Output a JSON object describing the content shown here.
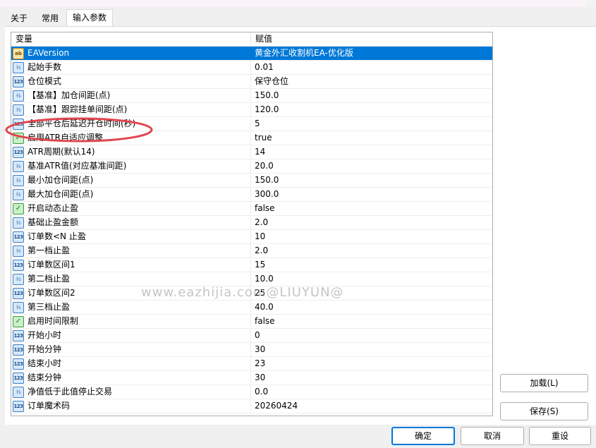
{
  "tabs": [
    {
      "label": "关于"
    },
    {
      "label": "常用"
    },
    {
      "label": "输入参数"
    }
  ],
  "table": {
    "headers": {
      "variable": "变量",
      "value": "赋值"
    },
    "rows": [
      {
        "icon": "ab",
        "name": "EAVersion",
        "value": "黄金外汇收割机EA-优化版",
        "selected": true
      },
      {
        "icon": "frac",
        "name": "起始手数",
        "value": "0.01"
      },
      {
        "icon": "num",
        "name": "仓位模式",
        "value": "保守仓位"
      },
      {
        "icon": "frac",
        "name": "【基准】加仓间距(点)",
        "value": "150.0"
      },
      {
        "icon": "frac",
        "name": "【基准】跟踪挂单间距(点)",
        "value": "120.0"
      },
      {
        "icon": "num",
        "name": "全部平仓后延迟开仓时间(秒)",
        "value": "5"
      },
      {
        "icon": "bool",
        "name": "启用ATR自适应调整",
        "value": "true"
      },
      {
        "icon": "num",
        "name": "ATR周期(默认14)",
        "value": "14"
      },
      {
        "icon": "frac",
        "name": "基准ATR值(对应基准间距)",
        "value": "20.0"
      },
      {
        "icon": "frac",
        "name": "最小加仓间距(点)",
        "value": "150.0"
      },
      {
        "icon": "frac",
        "name": "最大加仓间距(点)",
        "value": "300.0"
      },
      {
        "icon": "bool",
        "name": "开启动态止盈",
        "value": "false"
      },
      {
        "icon": "frac",
        "name": "基础止盈金额",
        "value": "2.0"
      },
      {
        "icon": "num",
        "name": "订单数<N 止盈",
        "value": "10"
      },
      {
        "icon": "frac",
        "name": "第一档止盈",
        "value": "2.0"
      },
      {
        "icon": "num",
        "name": "订单数区间1",
        "value": "15"
      },
      {
        "icon": "frac",
        "name": "第二档止盈",
        "value": "10.0"
      },
      {
        "icon": "num",
        "name": "订单数区间2",
        "value": "25"
      },
      {
        "icon": "frac",
        "name": "第三档止盈",
        "value": "40.0"
      },
      {
        "icon": "bool",
        "name": "启用时间限制",
        "value": "false"
      },
      {
        "icon": "num",
        "name": "开始小时",
        "value": "0"
      },
      {
        "icon": "num",
        "name": "开始分钟",
        "value": "30"
      },
      {
        "icon": "num",
        "name": "结束小时",
        "value": "23"
      },
      {
        "icon": "num",
        "name": "结束分钟",
        "value": "30"
      },
      {
        "icon": "frac",
        "name": "净值低于此值停止交易",
        "value": "0.0"
      },
      {
        "icon": "num",
        "name": "订单魔术码",
        "value": "20260424"
      }
    ]
  },
  "icon_glyphs": {
    "ab": "ab",
    "frac": "½",
    "num": "123",
    "bool": "✓"
  },
  "watermark": "www.eazhijia.com@LIUYUN@",
  "buttons": {
    "load": "加载(L)",
    "save": "保存(S)",
    "ok": "确定",
    "cancel": "取消",
    "reset": "重设"
  },
  "colors": {
    "selection": "#0078d7",
    "annotation": "#e0464f"
  }
}
